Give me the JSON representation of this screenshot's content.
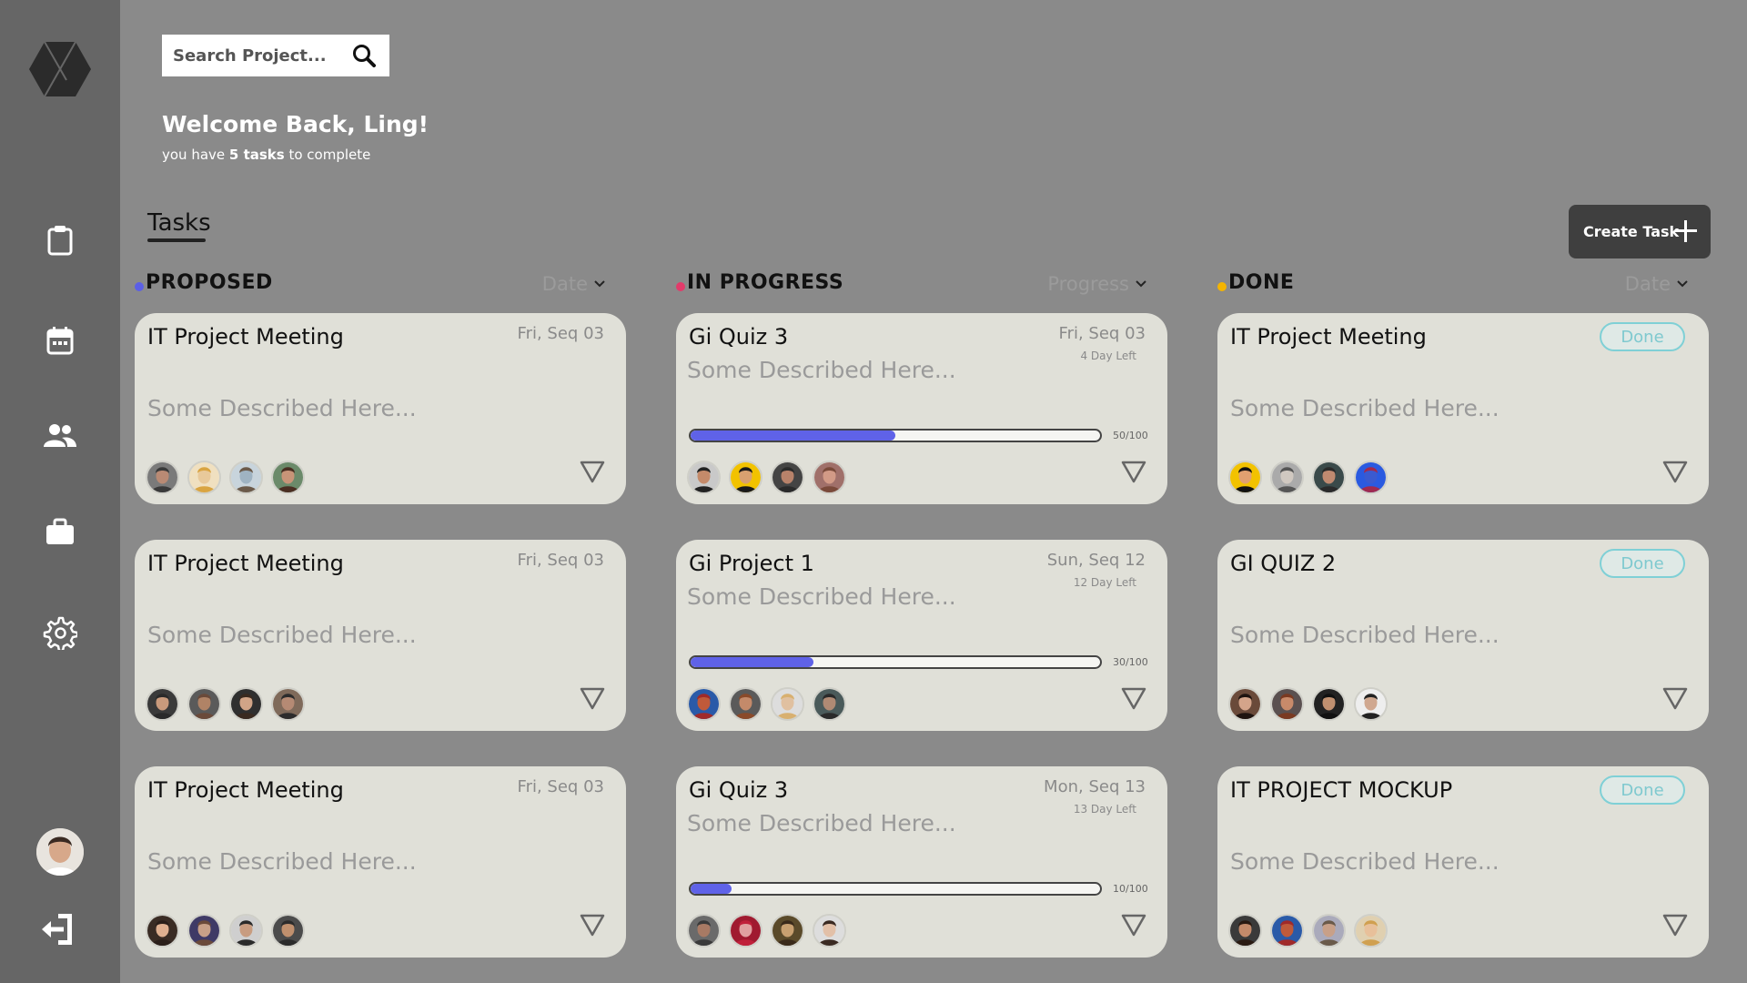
{
  "sidebar": {
    "logo_icon": "hexagon-logo-icon",
    "items": [
      {
        "icon": "clipboard-icon"
      },
      {
        "icon": "calendar-icon"
      },
      {
        "icon": "people-icon"
      },
      {
        "icon": "briefcase-icon"
      },
      {
        "icon": "gear-icon"
      }
    ],
    "logout_icon": "logout-icon"
  },
  "search": {
    "placeholder": "Search Project..."
  },
  "header": {
    "welcome": "Welcome Back, Ling!",
    "sub_prefix": "you have ",
    "sub_bold": "5 tasks",
    "sub_suffix": " to complete"
  },
  "tabs": {
    "tasks_label": "Tasks"
  },
  "create_task": {
    "label": "Create Task"
  },
  "colors": {
    "proposed": "#5b5fe6",
    "in_progress": "#e23a6a",
    "done": "#f4b400",
    "progress": "#5f62e8"
  },
  "columns": [
    {
      "title": "PROPOSED",
      "sort_label": "Date",
      "cards": [
        {
          "title": "IT Project Meeting",
          "date": "Fri, Seq 03",
          "desc": "Some Described Here..."
        },
        {
          "title": "IT Project Meeting",
          "date": "Fri, Seq 03",
          "desc": "Some Described Here..."
        },
        {
          "title": "IT Project Meeting",
          "date": "Fri, Seq 03",
          "desc": "Some Described Here..."
        }
      ]
    },
    {
      "title": "IN PROGRESS",
      "sort_label": "Progress",
      "cards": [
        {
          "title": "Gi Quiz 3",
          "date": "Fri, Seq 03",
          "days_left": "4 Day Left",
          "desc": "Some Described Here...",
          "progress": 0.5,
          "progress_text": "50/100"
        },
        {
          "title": "Gi Project 1",
          "date": "Sun, Seq 12",
          "days_left": "12 Day Left",
          "desc": "Some Described Here...",
          "progress": 0.3,
          "progress_text": "30/100"
        },
        {
          "title": "Gi Quiz 3",
          "date": "Mon, Seq 13",
          "days_left": "13 Day Left",
          "desc": "Some Described Here...",
          "progress": 0.1,
          "progress_text": "10/100"
        }
      ]
    },
    {
      "title": "DONE",
      "sort_label": "Date",
      "cards": [
        {
          "title": "IT Project Meeting",
          "badge": "Done",
          "desc": "Some Described Here..."
        },
        {
          "title": "GI QUIZ 2",
          "badge": "Done",
          "desc": "Some Described Here..."
        },
        {
          "title": "IT PROJECT MOCKUP",
          "badge": "Done",
          "desc": "Some Described Here..."
        }
      ]
    }
  ]
}
